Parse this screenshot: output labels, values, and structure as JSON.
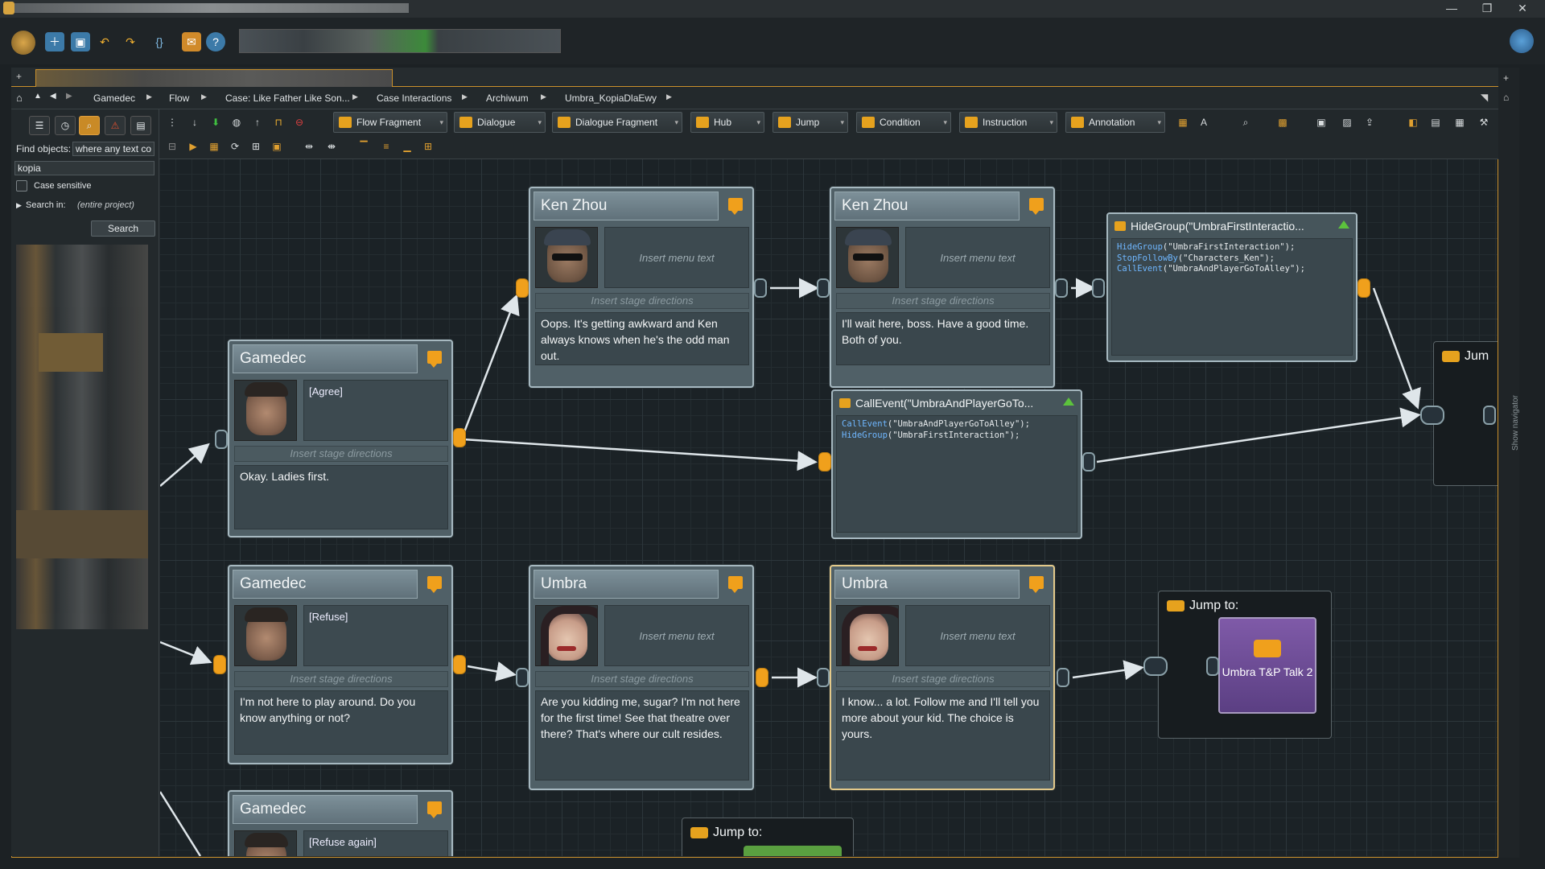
{
  "window": {
    "minimize": "—",
    "restore": "❐",
    "close": "✕"
  },
  "breadcrumb": [
    "Gamedec",
    "Flow",
    "Case: Like Father Like Son...",
    "Case Interactions",
    "Archiwum",
    "Umbra_KopiaDlaEwy"
  ],
  "find": {
    "label": "Find objects:",
    "scope_value": "where any text co",
    "query": "kopia",
    "case_sensitive": "Case sensitive",
    "search_in_label": "Search in:",
    "search_in_value": "(entire project)",
    "search_button": "Search"
  },
  "flow_toolbar": {
    "buttons": [
      "Flow Fragment",
      "Dialogue",
      "Dialogue Fragment",
      "Hub",
      "Jump",
      "Condition",
      "Instruction",
      "Annotation"
    ]
  },
  "nodes": {
    "gamedec1": {
      "speaker": "Gamedec",
      "menu": "[Agree]",
      "stage": "Insert stage directions",
      "text": "Okay. Ladies first."
    },
    "ken1": {
      "speaker": "Ken Zhou",
      "menu": "Insert menu text",
      "stage": "Insert stage directions",
      "text": "Oops. It's getting awkward and Ken always knows when he's the odd man out."
    },
    "ken2": {
      "speaker": "Ken Zhou",
      "menu": "Insert menu text",
      "stage": "Insert stage directions",
      "text": "I'll wait here, boss. Have a good time. Both of you."
    },
    "gamedec2": {
      "speaker": "Gamedec",
      "menu": "[Refuse]",
      "stage": "Insert stage directions",
      "text": "I'm not here to play around. Do you know anything or not?"
    },
    "umbra1": {
      "speaker": "Umbra",
      "menu": "Insert menu text",
      "stage": "Insert stage directions",
      "text": "Are you kidding me, sugar? I'm not here for the first time! See that theatre over there? That's where our cult resides."
    },
    "umbra2": {
      "speaker": "Umbra",
      "menu": "Insert menu text",
      "stage": "Insert stage directions",
      "text": "I know... a lot. Follow me and I'll tell you more about your kid. The choice is yours."
    },
    "gamedec3": {
      "speaker": "Gamedec",
      "menu": "[Refuse again]"
    }
  },
  "instructions": {
    "hide": {
      "title": "HideGroup(\"UmbraFirstInteractio...",
      "lines": [
        {
          "fn": "HideGroup",
          "args": "(\"UmbraFirstInteraction\");"
        },
        {
          "fn": "StopFollowBy",
          "args": "(\"Characters_Ken\");"
        },
        {
          "fn": "CallEvent",
          "args": "(\"UmbraAndPlayerGoToAlley\");"
        }
      ]
    },
    "call": {
      "title": "CallEvent(\"UmbraAndPlayerGoTo...",
      "lines": [
        {
          "fn": "CallEvent",
          "args": "(\"UmbraAndPlayerGoToAlley\");"
        },
        {
          "fn": "HideGroup",
          "args": "(\"UmbraFirstInteraction\");"
        }
      ]
    }
  },
  "jumps": {
    "j1": {
      "label": "Jump to:",
      "target": "Umbra T&P Talk 2"
    },
    "j2": {
      "label": "Jump to:"
    },
    "j3": {
      "label": "Jum"
    }
  },
  "navigator": "Show navigator",
  "colors": {
    "accent": "#c9902c",
    "output_port": "#f0a01c",
    "jump_target": "#6a4a93"
  }
}
